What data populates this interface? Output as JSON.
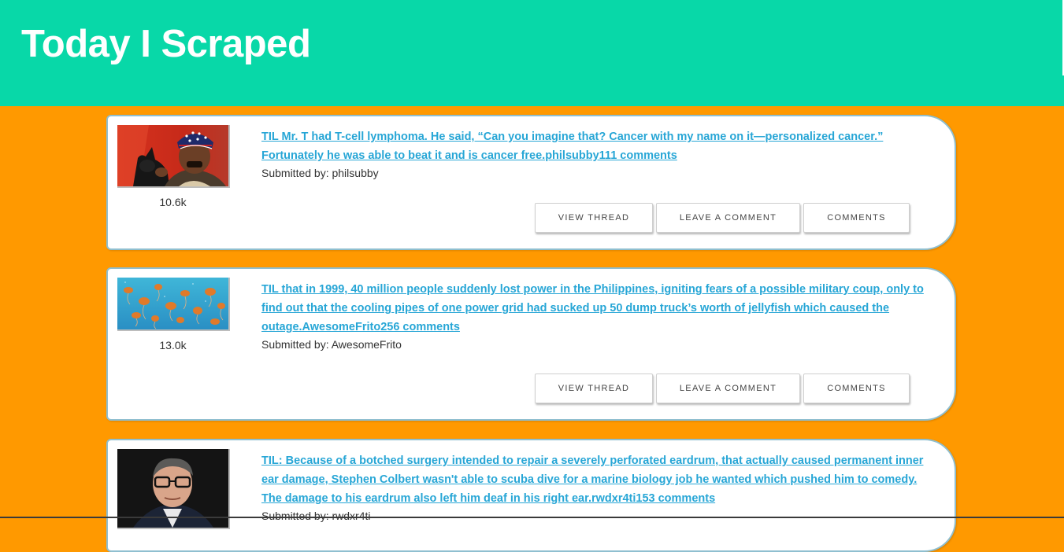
{
  "header": {
    "title": "Today I Scraped",
    "bg_color": "#08D8A8"
  },
  "page": {
    "bg_color": "#FF9900",
    "link_color": "#27a6d6"
  },
  "posts": [
    {
      "title": "TIL Mr. T had T-cell lymphoma. He said, “Can you imagine that? Cancer with my name on it—personalized cancer.” Fortunately he was able to beat it and is cancer free.philsubby111 comments",
      "submitted": "Submitted by: philsubby",
      "score": "10.6k",
      "thumbnail_icon": "man-in-bandana-with-cat-image",
      "buttons": [
        "VIEW THREAD",
        "LEAVE A COMMENT",
        "COMMENTS"
      ]
    },
    {
      "title": "TIL that in 1999, 40 million people suddenly lost power in the Philippines, igniting fears of a possible military coup, only to find out that the cooling pipes of one power grid had sucked up 50 dump truck’s worth of jellyfish which caused the outage.AwesomeFrito256 comments",
      "submitted": "Submitted by: AwesomeFrito",
      "score": "13.0k",
      "thumbnail_icon": "jellyfish-image",
      "buttons": [
        "VIEW THREAD",
        "LEAVE A COMMENT",
        "COMMENTS"
      ]
    },
    {
      "title": "TIL: Because of a botched surgery intended to repair a severely perforated eardrum, that actually caused permanent inner ear damage, Stephen Colbert wasn't able to scuba dive for a marine biology job he wanted which pushed him to comedy. The damage to his eardrum also left him deaf in his right ear.rwdxr4ti153 comments",
      "submitted": "Submitted by: rwdxr4ti",
      "thumbnail_icon": "man-with-glasses-portrait-image"
    }
  ]
}
